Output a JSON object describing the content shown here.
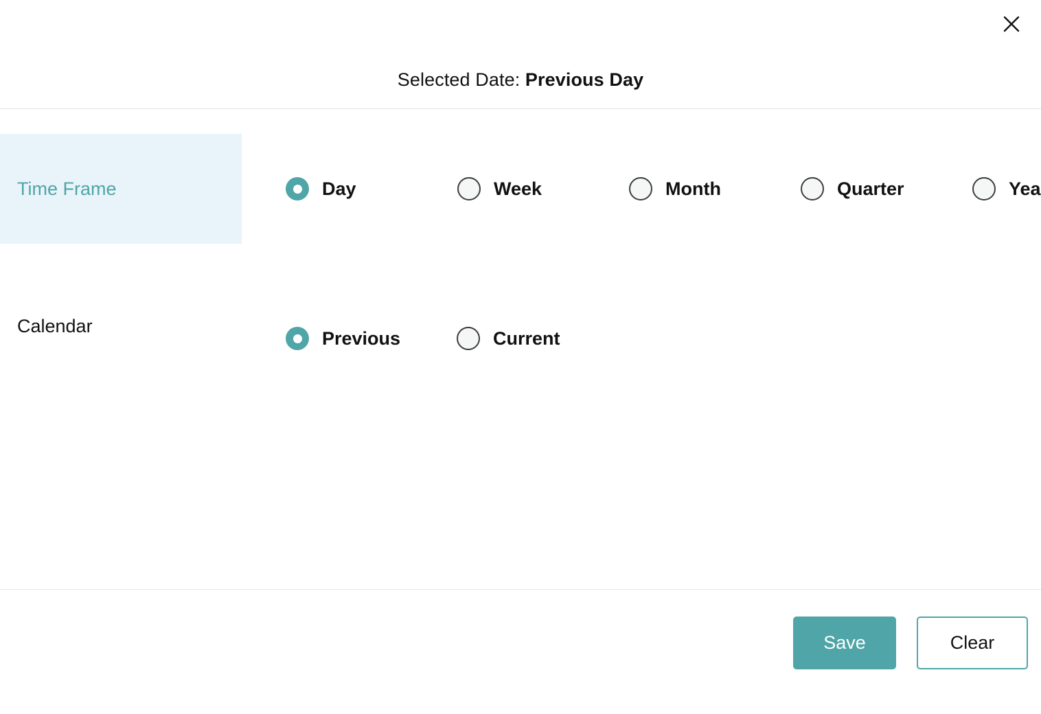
{
  "header": {
    "title_prefix": "Selected Date: ",
    "title_value": "Previous Day",
    "close_icon": "close-icon",
    "close_label": "Close"
  },
  "sections": [
    {
      "label": "Time Frame",
      "active": true,
      "options": [
        {
          "label": "Day",
          "selected": true
        },
        {
          "label": "Week",
          "selected": false
        },
        {
          "label": "Month",
          "selected": false
        },
        {
          "label": "Quarter",
          "selected": false
        },
        {
          "label": "Year",
          "selected": false
        }
      ]
    },
    {
      "label": "Calendar",
      "active": false,
      "options": [
        {
          "label": "Previous",
          "selected": true
        },
        {
          "label": "Current",
          "selected": false
        }
      ]
    }
  ],
  "footer": {
    "save_label": "Save",
    "clear_label": "Clear"
  },
  "colors": {
    "accent": "#4fa5a7",
    "active_tab_bg": "#e9f4fa",
    "divider": "#e3e5ea",
    "radio_unselected_bg": "#f5f6f6",
    "radio_unselected_border": "#3c3c3c",
    "text": "#111111"
  }
}
